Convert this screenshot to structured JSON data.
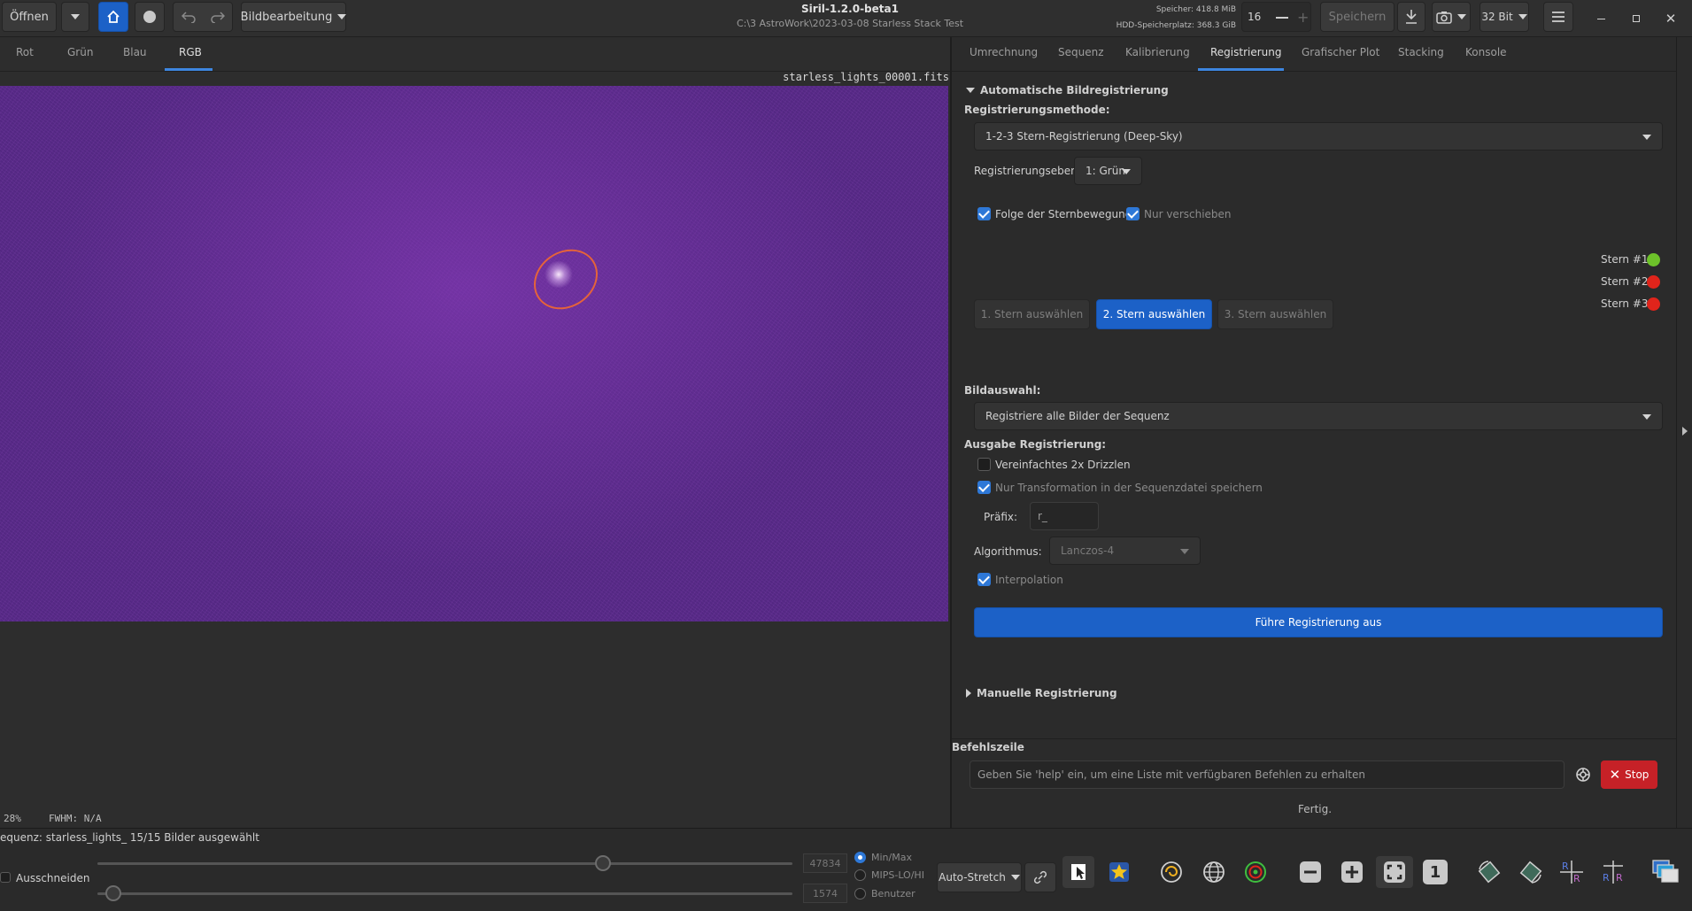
{
  "header": {
    "open_label": "Öffnen",
    "image_processing_label": "Bildbearbeitung",
    "app_title": "Siril-1.2.0-beta1",
    "path": "C:\\3 AstroWork\\2023-03-08 Starless Stack Test",
    "memory": "Speicher: 418.8 MiB",
    "disk": "HDD-Speicherplatz: 368.3 GiB",
    "threads_value": "16",
    "save_label": "Speichern",
    "bitdepth_label": "32 Bit"
  },
  "channel_tabs": [
    "Rot",
    "Grün",
    "Blau",
    "RGB"
  ],
  "image": {
    "filename": "starless_lights_00001.fits",
    "zoom": "28%",
    "fwhm": "FWHM: N/A"
  },
  "sequence_status": "equenz: starless_lights_ 15/15 Bilder ausgewählt",
  "right_tabs": [
    "Umrechnung",
    "Sequenz",
    "Kalibrierung",
    "Registrierung",
    "Grafischer Plot",
    "Stacking",
    "Konsole"
  ],
  "registration": {
    "section_title": "Automatische Bildregistrierung",
    "method_label": "Registrierungsmethode:",
    "method_value": "1-2-3 Stern-Registrierung (Deep-Sky)",
    "layer_label": "Registrierungsebene:",
    "layer_value": "1: Grün",
    "follow_star_label": "Folge der Sternbewegung",
    "shift_only_label": "Nur verschieben",
    "stars": [
      {
        "label": "Stern #1:",
        "color": "#6dc22a"
      },
      {
        "label": "Stern #2:",
        "color": "#e0241b"
      },
      {
        "label": "Stern #3:",
        "color": "#e0241b"
      }
    ],
    "star_buttons": [
      "1. Stern auswählen",
      "2. Stern auswählen",
      "3. Stern auswählen"
    ],
    "image_selection_label": "Bildauswahl:",
    "image_selection_value": "Registriere alle Bilder der Sequenz",
    "output_label": "Ausgabe Registrierung:",
    "drizzle_label": "Vereinfachtes 2x Drizzlen",
    "transform_only_label": "Nur Transformation in der Sequenzdatei speichern",
    "prefix_label": "Präfix:",
    "prefix_value": "r_",
    "algorithm_label": "Algorithmus:",
    "algorithm_value": "Lanczos-4",
    "interpolation_label": "Interpolation",
    "run_button": "Führe Registrierung aus",
    "manual_title": "Manuelle Registrierung"
  },
  "command_line": {
    "title": "Befehlszeile",
    "placeholder": "Geben Sie 'help' ein, um eine Liste mit verfügbaren Befehlen zu erhalten",
    "stop_label": "Stop",
    "status": "Fertig."
  },
  "bottom": {
    "crop_label": "Ausschneiden",
    "high_value": "47834",
    "low_value": "1574",
    "radio_options": [
      "Min/Max",
      "MIPS-LO/HI",
      "Benutzer"
    ],
    "stretch_label": "Auto-Stretch",
    "zoom_one_label": "1"
  },
  "colors": {
    "accent_blue": "#1c61c7",
    "stop_red": "#c62127",
    "image_purple": "#5a2a8c"
  }
}
